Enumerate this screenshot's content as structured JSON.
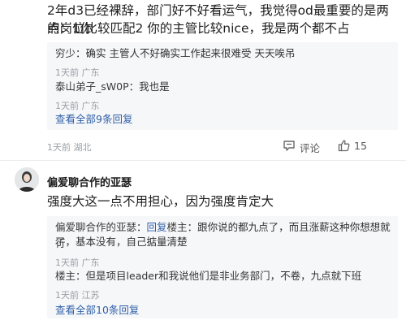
{
  "comment1": {
    "text_line1": "2年d3已经裸辞，部门好不好看运气，我觉得od最重要的是两点：1你",
    "text_line2": "的岗位比较匹配2 你的主管比较nice，我是两个都不占",
    "replies": [
      {
        "name": "穷少",
        "sep": "：",
        "text": "确实 主管人不好确实工作起来很难受 天天唉吊",
        "meta": "1天前  广东"
      },
      {
        "name": "泰山弟子_sW0P",
        "sep": "：",
        "text": "我也是",
        "meta": "1天前  广东"
      }
    ],
    "more_replies": "查看全部9条回复",
    "meta": "1天前  湖北",
    "comment_label": "评论",
    "like_count": "15"
  },
  "comment2": {
    "user_name": "偏爱聊合作的亚瑟",
    "text": "强度大这一点不用担心，因为强度肯定大",
    "reply1": {
      "name": "偏爱聊合作的亚瑟",
      "sep": "：",
      "reply_to_prefix": "回复",
      "reply_to_user": "楼主",
      "sep2": "：",
      "text_line1": "跟你说的都九点了，而且涨薪这种你想想就行",
      "text_line2": "了，基本没有，自己掂量清楚",
      "meta": "1天前  广东"
    },
    "reply2": {
      "name": "楼主",
      "sep": "：",
      "text": "但是项目leader和我说他们是非业务部门，不卷，九点就下班",
      "meta": "1天前  江苏"
    },
    "more_replies": "查看全部10条回复"
  },
  "colors": {
    "link": "#2f5fa8",
    "meta": "#9aa0a6",
    "reply_bg": "#f6f7f9"
  },
  "icons": [
    "comment-icon",
    "like-icon",
    "avatar"
  ]
}
